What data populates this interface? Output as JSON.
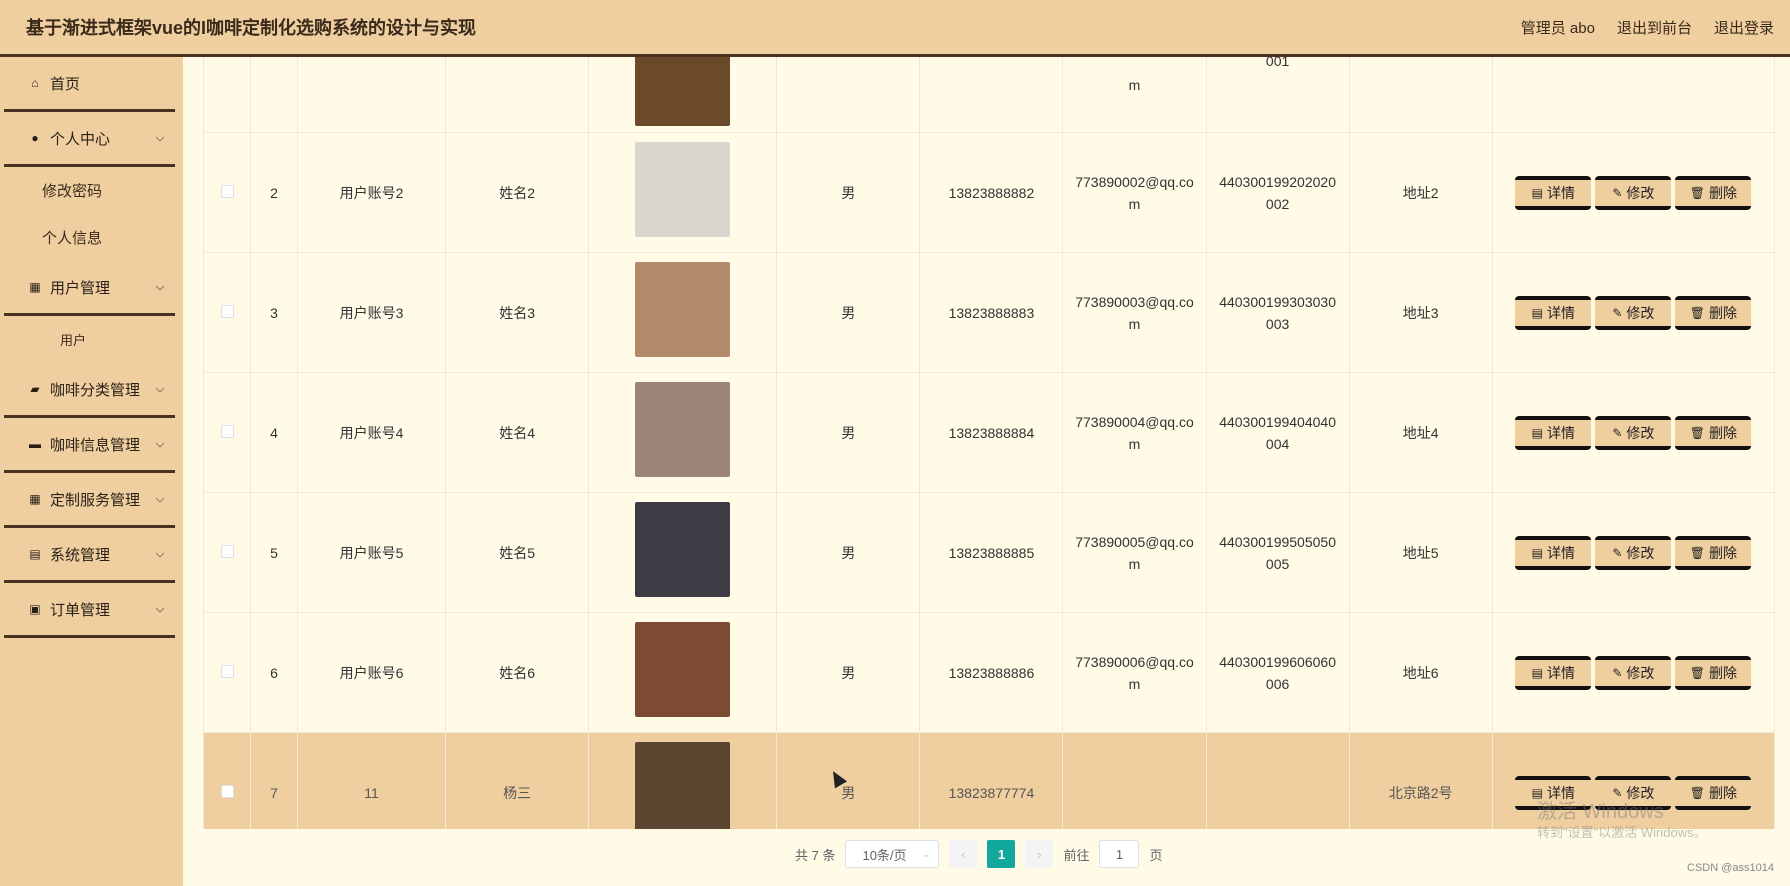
{
  "header": {
    "title": "基于渐进式框架vue的I咖啡定制化选购系统的设计与实现",
    "admin_label": "管理员 abo",
    "front_label": "退出到前台",
    "logout_label": "退出登录"
  },
  "sidebar": {
    "home": "首页",
    "personal_center": "个人中心",
    "change_password": "修改密码",
    "personal_info": "个人信息",
    "user_mgmt": "用户管理",
    "user": "用户",
    "coffee_category_mgmt": "咖啡分类管理",
    "coffee_info_mgmt": "咖啡信息管理",
    "custom_service_mgmt": "定制服务管理",
    "system_mgmt": "系统管理",
    "order_mgmt": "订单管理"
  },
  "table": {
    "buttons": {
      "detail": "详情",
      "edit": "修改",
      "delete": "删除"
    },
    "partial_top": {
      "email_tail": "m",
      "id_tail": "001"
    },
    "rows": [
      {
        "index": "2",
        "account": "用户账号2",
        "name": "姓名2",
        "gender": "男",
        "phone": "13823888882",
        "email": "773890002@qq.com",
        "idcard": "440300199202020002",
        "address": "地址2",
        "photo_color": "#d9d6cf"
      },
      {
        "index": "3",
        "account": "用户账号3",
        "name": "姓名3",
        "gender": "男",
        "phone": "13823888883",
        "email": "773890003@qq.com",
        "idcard": "440300199303030003",
        "address": "地址3",
        "photo_color": "#b38a6a"
      },
      {
        "index": "4",
        "account": "用户账号4",
        "name": "姓名4",
        "gender": "男",
        "phone": "13823888884",
        "email": "773890004@qq.com",
        "idcard": "440300199404040004",
        "address": "地址4",
        "photo_color": "#9c8378"
      },
      {
        "index": "5",
        "account": "用户账号5",
        "name": "姓名5",
        "gender": "男",
        "phone": "13823888885",
        "email": "773890005@qq.com",
        "idcard": "440300199505050005",
        "address": "地址5",
        "photo_color": "#3d3c44"
      },
      {
        "index": "6",
        "account": "用户账号6",
        "name": "姓名6",
        "gender": "男",
        "phone": "13823888886",
        "email": "773890006@qq.com",
        "idcard": "440300199606060006",
        "address": "地址6",
        "photo_color": "#7d4b33"
      },
      {
        "index": "7",
        "account": "11",
        "name": "杨三",
        "gender": "男",
        "phone": "13823877774",
        "email": "",
        "idcard": "",
        "address": "北京路2号",
        "photo_color": "#5a4530"
      }
    ]
  },
  "pager": {
    "total": "共 7 条",
    "page_size": "10条/页",
    "current": "1",
    "goto_label": "前往",
    "goto_value": "1",
    "page_unit": "页"
  },
  "overlay": {
    "activate_title": "激活 Windows",
    "activate_sub": "转到\"设置\"以激活 Windows。",
    "credit": "CSDN @ass1014"
  },
  "colors": {
    "accent": "#efcfa0",
    "dark": "#4a3220",
    "page_active": "#13a89e"
  }
}
